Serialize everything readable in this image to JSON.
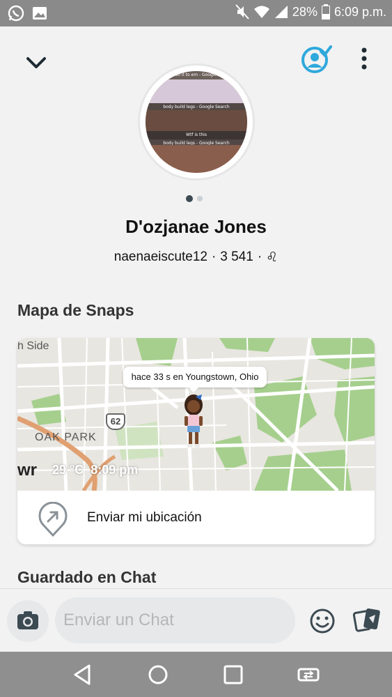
{
  "status_bar": {
    "battery": "28%",
    "time": "6:09 p.m."
  },
  "profile": {
    "display_name": "D'ozjanae Jones",
    "username": "naenaeiscute12",
    "score": "3 541",
    "zodiac_symbol": "♌",
    "separator": "·",
    "avatar_captions": [
      "to do it to em - Google Se",
      "body build legs - Google Search",
      "Wtf is this",
      "body build legs - Google Search"
    ]
  },
  "snap_map": {
    "section_title": "Mapa de Snaps",
    "location_bubble": "hace 33 s en Youngstown, Ohio",
    "labels": {
      "side": "h Side",
      "oak_park": "OAK PARK",
      "route": "62",
      "wr": "wr",
      "temperature": "29 °C",
      "time": "8:09 pm"
    },
    "send_location_label": "Enviar mi ubicación"
  },
  "saved_chat": {
    "section_title": "Guardado en Chat"
  },
  "chat_bar": {
    "placeholder": "Enviar un Chat"
  },
  "colors": {
    "accent_blue": "#2fa8dc",
    "map_green": "#a6cf8e",
    "road_orange": "#e0a071"
  }
}
